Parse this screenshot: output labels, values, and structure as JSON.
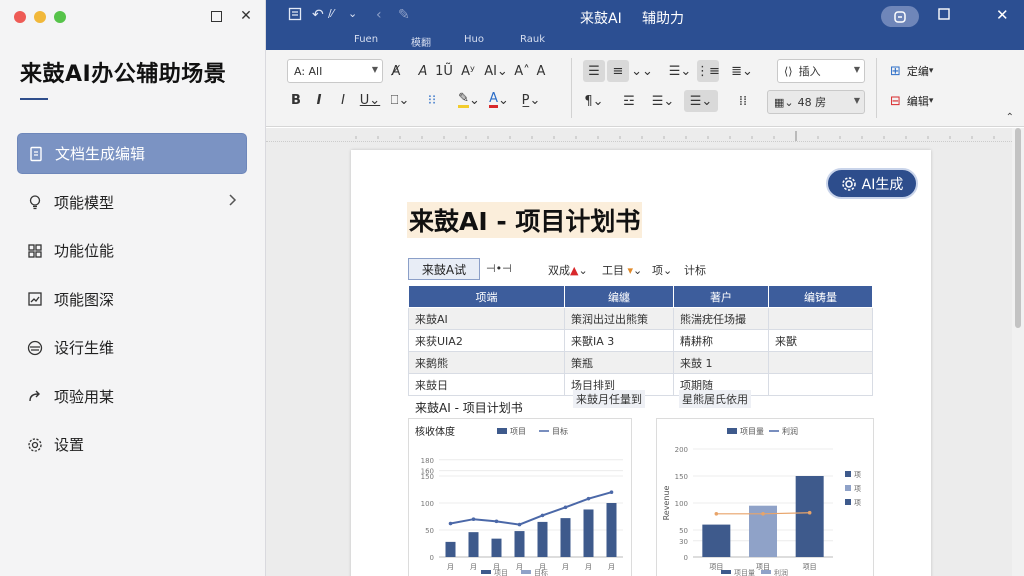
{
  "sidebar": {
    "brand": "来鼓AI办公辅助场景",
    "items": [
      {
        "label": "文档生成编辑",
        "icon": "document-icon",
        "active": true
      },
      {
        "label": "项能模型",
        "icon": "lightbulb-icon",
        "active": false,
        "chevron": true
      },
      {
        "label": "功能位能",
        "icon": "grid-icon",
        "active": false
      },
      {
        "label": "项能图深",
        "icon": "chart-icon",
        "active": false
      },
      {
        "label": "设行生维",
        "icon": "layers-icon",
        "active": false
      },
      {
        "label": "项验用某",
        "icon": "share-icon",
        "active": false
      },
      {
        "label": "设置",
        "icon": "gear-icon",
        "active": false
      }
    ]
  },
  "titlebar": {
    "title": "来鼓AI",
    "subtitle": "辅助力",
    "tabs": [
      "Fuen",
      "模翻",
      "Huo",
      "Rauk"
    ]
  },
  "ribbon": {
    "font_name": "A: AlI",
    "insert_label": "插入",
    "number_box": "48 房",
    "right_top": "定编",
    "right_bottom": "编辑"
  },
  "document": {
    "ai_button": "AI生成",
    "title": "来鼓AI - 项目计划书",
    "mini_toolbar": {
      "tab": "来鼓A试",
      "items": [
        "⊣•⊣",
        "双成",
        "工目",
        "项",
        "计标"
      ]
    },
    "table": {
      "headers": [
        "项端",
        "编纏",
        "著户",
        "编铸量"
      ],
      "rows": [
        [
          "来鼓AI",
          "策润出过出熊策",
          "熊湍疣任场撮",
          ""
        ],
        [
          "来获UIA2",
          "来獸IA 3",
          "精耕称",
          "来獸"
        ],
        [
          "来鹅熊",
          "策瓶",
          "来鼓 1",
          ""
        ],
        [
          "来鼓日",
          "场目排到",
          "项期随",
          ""
        ]
      ]
    },
    "subtitle": "来鼓AI - 项目计划书",
    "float_a": "来鼓月任量到",
    "float_b": "星熊居氏依用"
  },
  "chart_data": [
    {
      "type": "bar",
      "title": "核收体度",
      "legend": [
        "项目",
        "目标"
      ],
      "categories": [
        "月",
        "月",
        "月",
        "月",
        "月",
        "月",
        "月",
        "月"
      ],
      "y_ticks": [
        0,
        50,
        100,
        150,
        160,
        180
      ],
      "ylim": [
        0,
        200
      ],
      "series": [
        {
          "name": "项目",
          "kind": "bar",
          "values": [
            28,
            46,
            34,
            48,
            65,
            72,
            88,
            100
          ]
        },
        {
          "name": "目标",
          "kind": "line",
          "values": [
            62,
            70,
            66,
            60,
            77,
            92,
            108,
            120
          ]
        }
      ]
    },
    {
      "type": "bar",
      "legend": [
        "项目量",
        "利润"
      ],
      "ylabel": "Revenue",
      "categories": [
        "项目",
        "项目",
        "项目"
      ],
      "y_ticks": [
        0,
        30,
        50,
        100,
        150,
        200
      ],
      "ylim": [
        0,
        200
      ],
      "series": [
        {
          "name": "项目量",
          "kind": "bar",
          "values": [
            60,
            95,
            150
          ]
        },
        {
          "name": "利润",
          "kind": "line",
          "values": [
            80,
            80,
            82
          ]
        }
      ],
      "right_legend": [
        "项",
        "项",
        "项"
      ]
    }
  ],
  "colors": {
    "primary": "#2c4f92",
    "active_nav": "#7b93c3",
    "table_header": "#3d5d9c",
    "bar": "#3e5a8c",
    "line": "#4b68a8",
    "target_line": "#e8a46a"
  }
}
